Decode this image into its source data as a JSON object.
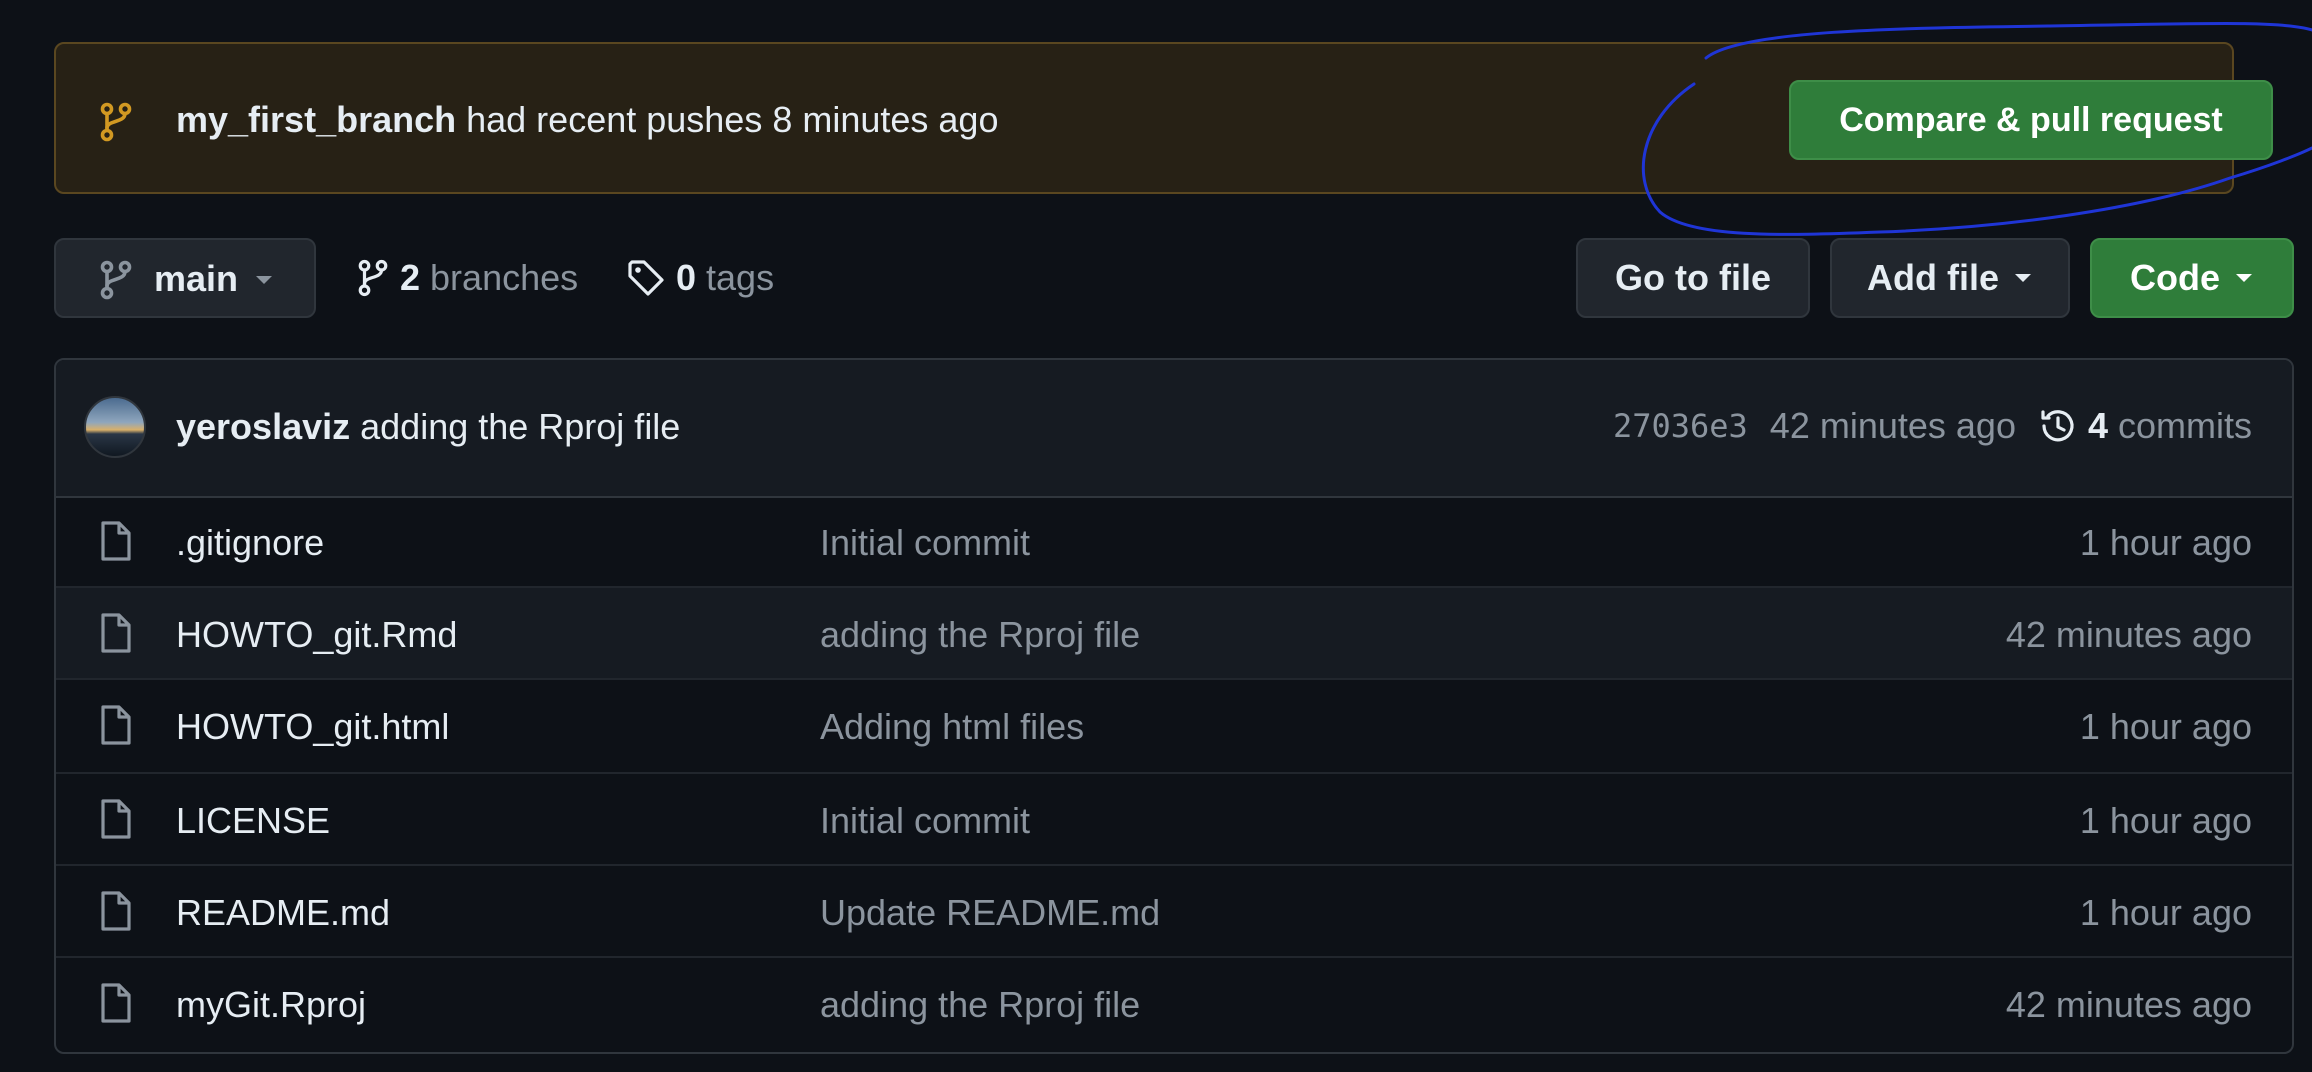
{
  "banner": {
    "branch": "my_first_branch",
    "message": " had recent pushes 8 minutes ago",
    "compare_button": "Compare & pull request"
  },
  "toolbar": {
    "branch_label": "main",
    "branches_count": "2",
    "branches_label": "branches",
    "tags_count": "0",
    "tags_label": "tags",
    "go_to_file": "Go to file",
    "add_file": "Add file",
    "code": "Code"
  },
  "latest_commit": {
    "author": "yeroslaviz",
    "message": " adding the Rproj file",
    "sha": "27036e3",
    "time": "42 minutes ago",
    "commits_count": "4",
    "commits_label": "commits"
  },
  "files": [
    {
      "name": ".gitignore",
      "message": "Initial commit",
      "time": "1 hour ago"
    },
    {
      "name": "HOWTO_git.Rmd",
      "message": "adding the Rproj file",
      "time": "42 minutes ago"
    },
    {
      "name": "HOWTO_git.html",
      "message": "Adding html files",
      "time": "1 hour ago"
    },
    {
      "name": "LICENSE",
      "message": "Initial commit",
      "time": "1 hour ago"
    },
    {
      "name": "README.md",
      "message": "Update README.md",
      "time": "1 hour ago"
    },
    {
      "name": "myGit.Rproj",
      "message": "adding the Rproj file",
      "time": "42 minutes ago"
    }
  ],
  "icons": {
    "banner": "git-branch-icon",
    "branch": "git-branch-icon",
    "tag": "tag-icon",
    "history": "history-icon",
    "file": "file-icon",
    "caret": "triangle-down-icon"
  },
  "colors": {
    "background": "#0d1117",
    "banner_bg": "#272115",
    "banner_border": "#5a4720",
    "accent_green": "#2f7d3a",
    "annotation": "#1f35d6",
    "muted_text": "#8b949e"
  }
}
